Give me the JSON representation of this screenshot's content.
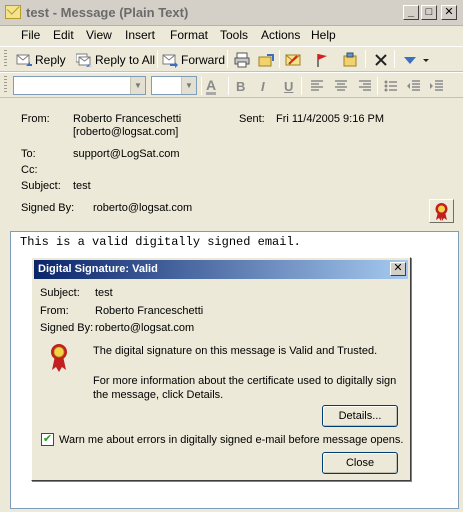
{
  "window": {
    "title": "test - Message (Plain Text)",
    "controls": {
      "minimize": "_",
      "maximize": "□",
      "close": "✕"
    }
  },
  "menu": [
    "File",
    "Edit",
    "View",
    "Insert",
    "Format",
    "Tools",
    "Actions",
    "Help"
  ],
  "toolbar": {
    "reply": "Reply",
    "reply_all": "Reply to All",
    "forward": "Forward"
  },
  "formatting": {
    "bold": "B",
    "italic": "I",
    "underline": "U"
  },
  "header": {
    "from_label": "From:",
    "from_name": "Roberto Franceschetti",
    "from_email": "[roberto@logsat.com]",
    "sent_label": "Sent:",
    "sent_value": "Fri 11/4/2005 9:16 PM",
    "to_label": "To:",
    "to_value": "support@LogSat.com",
    "cc_label": "Cc:",
    "cc_value": "",
    "subject_label": "Subject:",
    "subject_value": "test",
    "signed_label": "Signed By:",
    "signed_value": "roberto@logsat.com"
  },
  "body": {
    "text": "This is a valid digitally signed email."
  },
  "dialog": {
    "title": "Digital Signature: Valid",
    "close": "✕",
    "subject_label": "Subject:",
    "subject_value": "test",
    "from_label": "From:",
    "from_value": "Roberto Franceschetti",
    "signed_label": "Signed By:",
    "signed_value": "roberto@logsat.com",
    "status_message": "The digital signature on this message is Valid and Trusted.",
    "info_line1": "For more information about the certificate used to digitally sign",
    "info_line2": "the message, click Details.",
    "details_button": "Details...",
    "warn_checkbox_label": "Warn me about errors in digitally signed e-mail before message opens.",
    "warn_checked": true,
    "close_button": "Close"
  },
  "colors": {
    "dialog_title_start": "#0a246a",
    "dialog_title_end": "#a6caf0",
    "window_bg": "#ece9d8"
  }
}
